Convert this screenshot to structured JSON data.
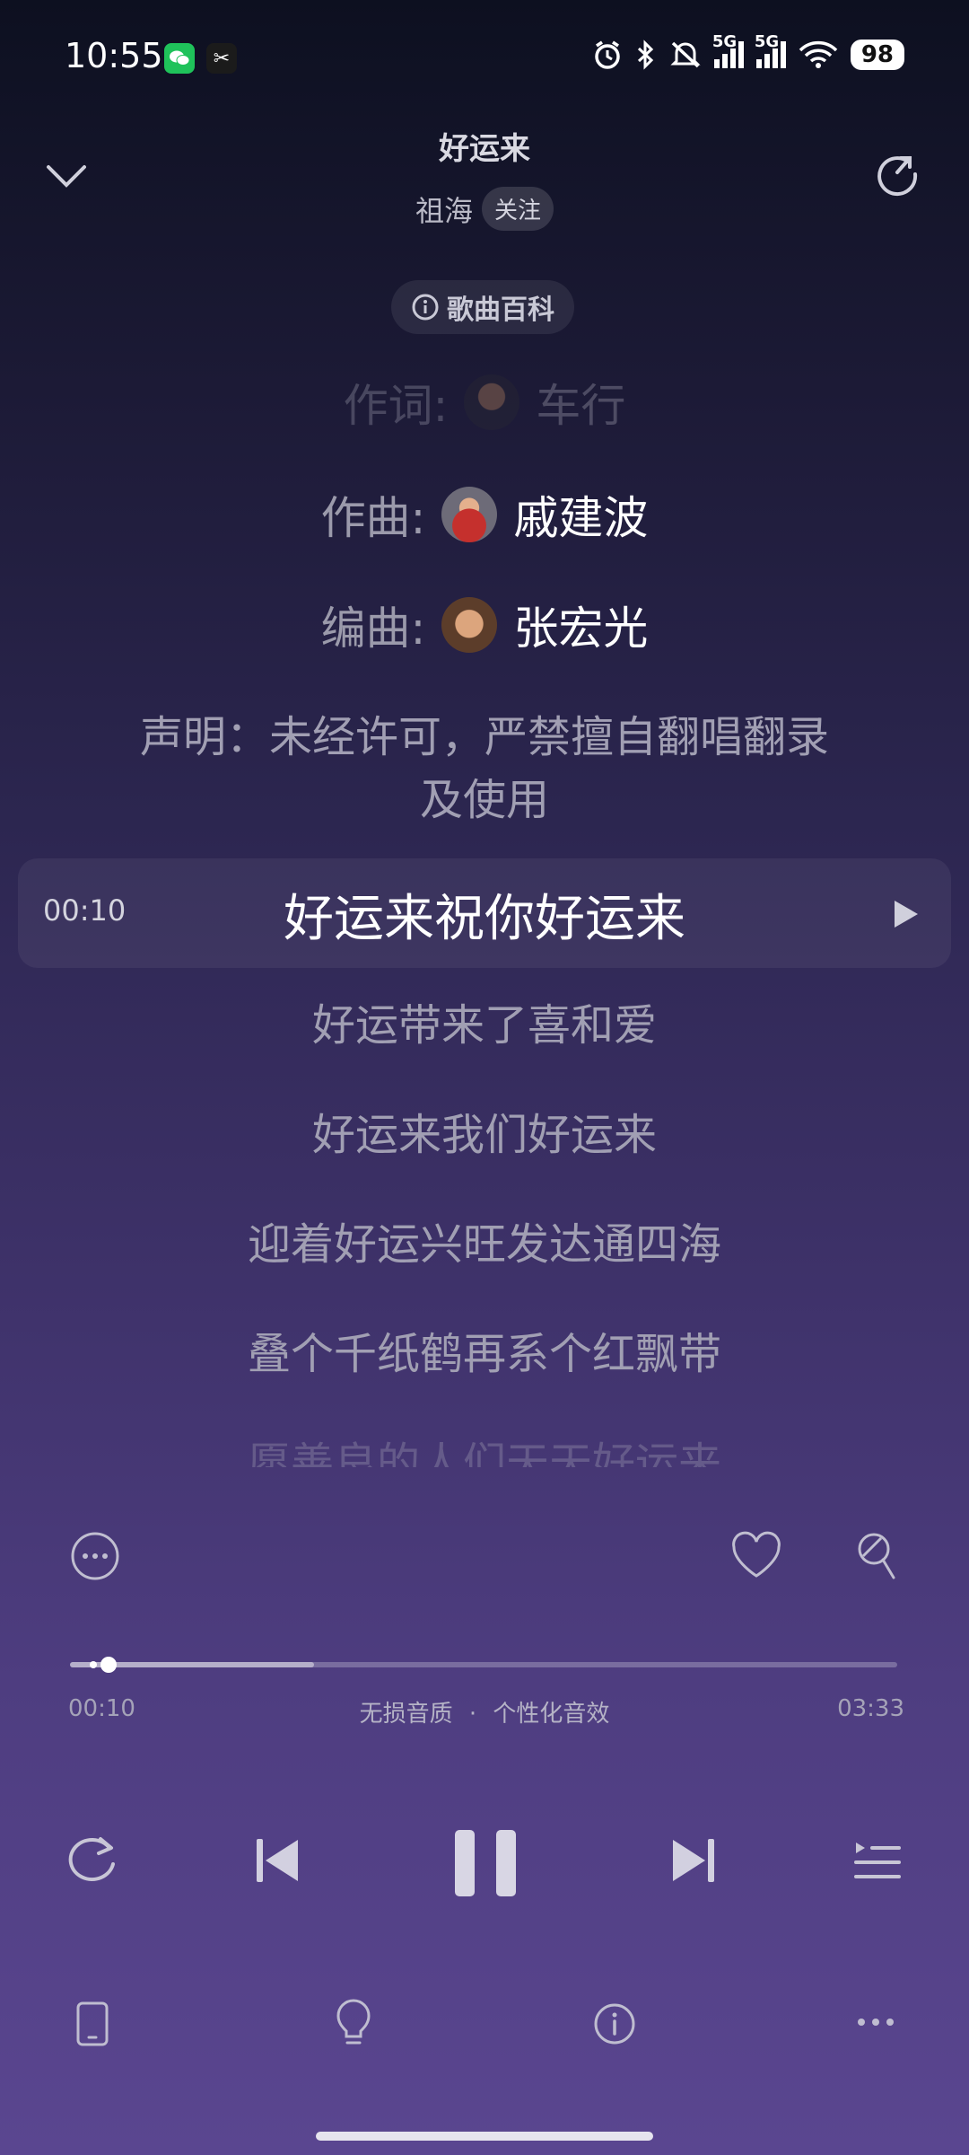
{
  "status": {
    "time": "10:55",
    "battery": "98",
    "signal_1": "5G",
    "signal_2": "5G",
    "wifi_sub": "6"
  },
  "header": {
    "title": "好运来",
    "artist": "祖海",
    "follow_label": "关注",
    "wiki_label": "歌曲百科"
  },
  "credits": [
    {
      "label": "作词:",
      "name": "车行"
    },
    {
      "label": "作曲:",
      "name": "戚建波"
    },
    {
      "label": "编曲:",
      "name": "张宏光"
    }
  ],
  "statement": {
    "line1": "声明：未经许可，严禁擅自翻唱翻录",
    "line2": "及使用"
  },
  "current": {
    "time": "00:10",
    "text": "好运来祝你好运来"
  },
  "lyrics": [
    "好运带来了喜和爱",
    "好运来我们好运来",
    "迎着好运兴旺发达通四海",
    "叠个千纸鹤再系个红飘带",
    "愿善良的人们天天好运来"
  ],
  "player": {
    "elapsed": "00:10",
    "total": "03:33",
    "quality": "无损音质",
    "sep": "·",
    "effect": "个性化音效",
    "progress_fraction": 0.047
  },
  "icons": {
    "top_left": "chevron-down-icon",
    "top_right": "share-icon",
    "more": "more-circle-icon",
    "like": "heart-icon",
    "sing": "microphone-icon",
    "repeat": "repeat-icon",
    "prev": "previous-icon",
    "pause": "pause-icon",
    "next": "next-icon",
    "playlist": "playlist-icon",
    "device": "phone-device-icon",
    "tip": "lightbulb-icon",
    "info": "info-icon",
    "menu": "dots-icon"
  }
}
